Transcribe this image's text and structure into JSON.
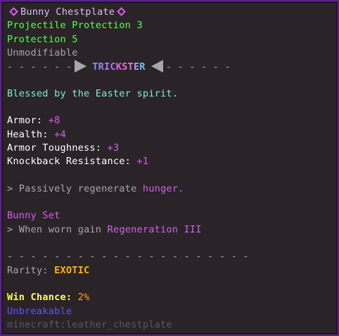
{
  "item": {
    "name": "Bunny Chestplate",
    "enchantments": [
      "Projectile Protection 3",
      "Protection 5"
    ],
    "modifiable_status": "Unmodifiable",
    "class_banner": {
      "left_dashes": "- - - - - -",
      "class_name": "TRICKSTER",
      "right_dashes": "- - - - - -"
    },
    "lore": "Blessed by the Easter spirit.",
    "stats": [
      {
        "label": "Armor:",
        "value": "+8"
      },
      {
        "label": "Health:",
        "value": "+4"
      },
      {
        "label": "Armor Toughness:",
        "value": "+3"
      },
      {
        "label": "Knockback Resistance:",
        "value": "+1"
      }
    ],
    "passive": {
      "prefix": "> Passively regenerate",
      "highlight": "hunger."
    },
    "set_bonus": {
      "title": "Bunny Set",
      "prefix": "> When worn gain",
      "highlight": "Regeneration III"
    },
    "separator": "- - - - - - - - - - - - - - - - - - - - -",
    "rarity": {
      "label": "Rarity:",
      "value": "EXOTIC"
    },
    "win_chance": {
      "label": "Win Chance:",
      "value": "2%"
    },
    "unbreakable": "Unbreakable",
    "item_id": "minecraft:leather_chestplate"
  },
  "colors": {
    "background": "#2a2428",
    "border": "#5a1f8f",
    "enchant": "#55ff55",
    "stat_value": "#d55fee",
    "lore": "#7df0c9",
    "rarity": "#ffb400",
    "win_label": "#ffff55",
    "unbreakable": "#5f55ff"
  }
}
